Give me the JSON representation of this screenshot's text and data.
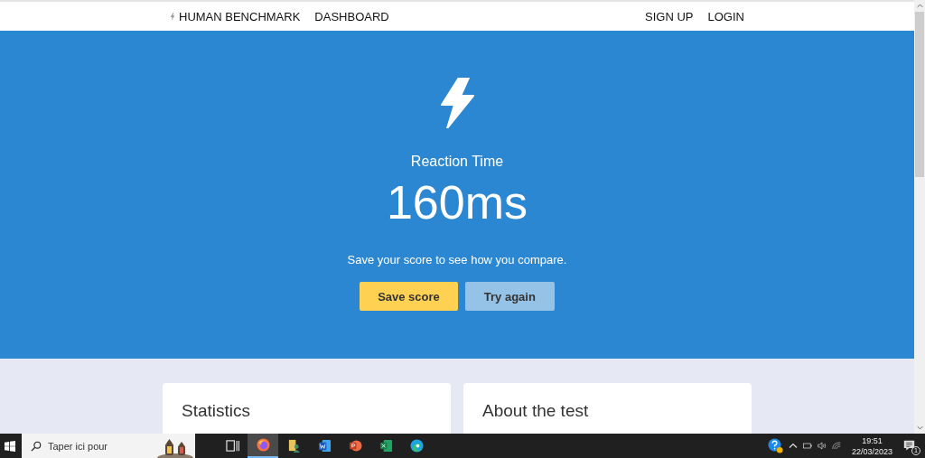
{
  "nav": {
    "brand": "HUMAN BENCHMARK",
    "links": [
      {
        "label": "DASHBOARD"
      }
    ],
    "right_links": [
      {
        "label": "SIGN UP"
      },
      {
        "label": "LOGIN"
      }
    ]
  },
  "hero": {
    "title": "Reaction Time",
    "score": "160ms",
    "message": "Save your score to see how you compare.",
    "buttons": [
      {
        "label": "Save score",
        "kind": "primary"
      },
      {
        "label": "Try again",
        "kind": "secondary"
      }
    ]
  },
  "cards": [
    {
      "title": "Statistics"
    },
    {
      "title": "About the test"
    }
  ],
  "taskbar": {
    "search": {
      "placeholder": "Taper ici pour"
    },
    "apps": [
      {
        "kind": "taskview",
        "selected": false
      },
      {
        "kind": "firefox",
        "selected": true
      },
      {
        "kind": "files",
        "selected": false
      },
      {
        "kind": "word",
        "selected": false
      },
      {
        "kind": "powerpoint",
        "selected": false
      },
      {
        "kind": "excel",
        "selected": false
      },
      {
        "kind": "edge",
        "selected": false
      }
    ],
    "time": "19:51",
    "date": "22/03/2023",
    "notifications": "1"
  }
}
